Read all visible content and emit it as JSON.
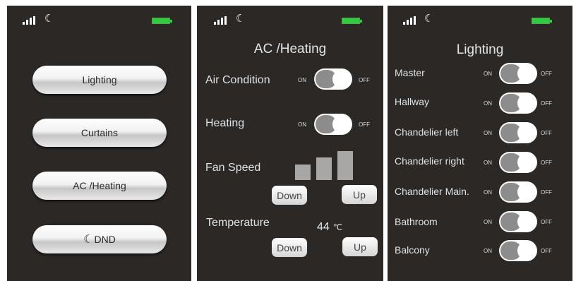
{
  "colors": {
    "screen_bg": "#2b2826",
    "battery": "#2ecc40",
    "button": "#f1f1f1",
    "toggle_track": "#8c8c8c"
  },
  "status_bar": {
    "signal_icon": "signal-bars-icon",
    "dnd_icon": "moon-icon",
    "battery_icon": "battery-icon"
  },
  "home": {
    "buttons": [
      "Lighting",
      "Curtains",
      "AC /Heating",
      "DND"
    ]
  },
  "ac": {
    "title": "AC /Heating",
    "air_condition": {
      "label": "Air Condition",
      "on": "ON",
      "off": "OFF",
      "state": "OFF"
    },
    "heating": {
      "label": "Heating",
      "on": "ON",
      "off": "OFF",
      "state": "OFF"
    },
    "fan": {
      "label": "Fan Speed",
      "levels": 3,
      "down": "Down",
      "up": "Up"
    },
    "temperature": {
      "label": "Temperature",
      "value": "44",
      "unit": "℃",
      "down": "Down",
      "up": "Up"
    }
  },
  "lighting": {
    "title": "Lighting",
    "on": "ON",
    "off": "OFF",
    "items": [
      "Master",
      "Hallway",
      "Chandelier left",
      "Chandelier right",
      "Chandelier Main.",
      "Bathroom",
      "Balcony"
    ]
  }
}
